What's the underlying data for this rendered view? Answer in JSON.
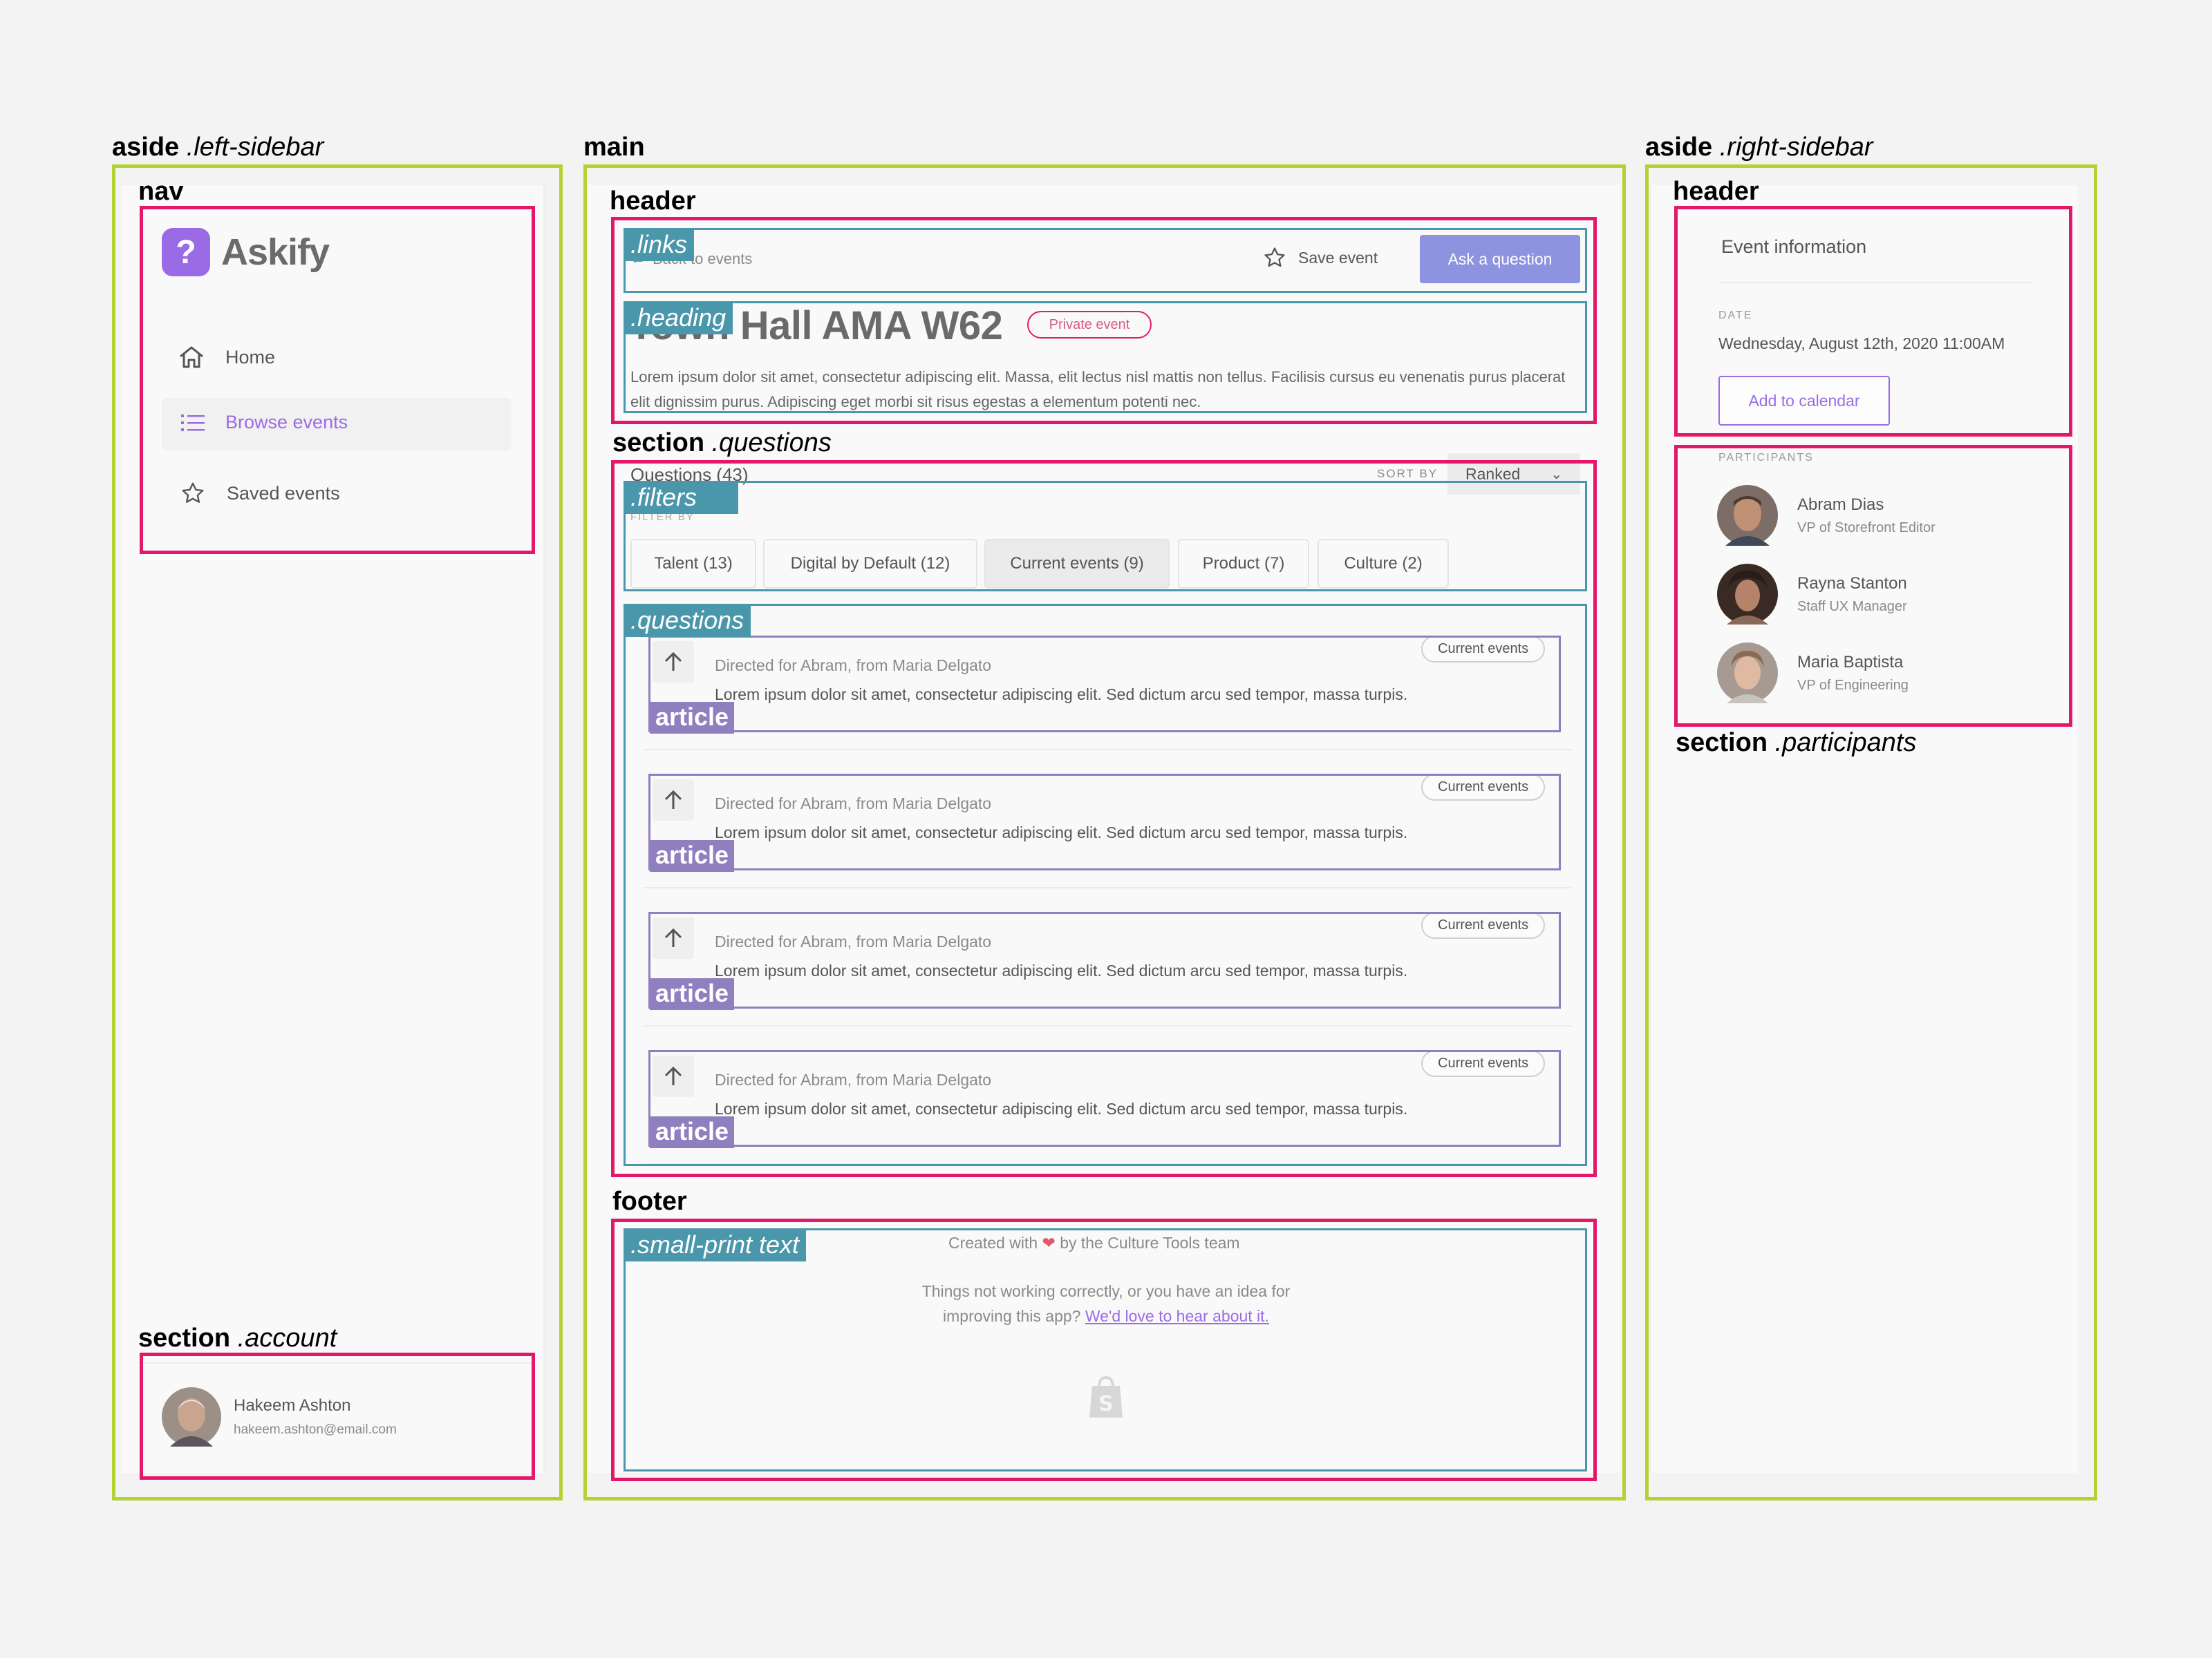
{
  "annotations": {
    "left_sidebar": {
      "tag": "aside",
      "cls": ".left-sidebar"
    },
    "main": "main",
    "right_sidebar": {
      "tag": "aside",
      "cls": ".right-sidebar"
    },
    "nav": "nav",
    "header": "header",
    "right_header": "header",
    "questions_section": {
      "tag": "section",
      "cls": ".questions"
    },
    "account_section": {
      "tag": "section",
      "cls": ".account"
    },
    "participants_section": {
      "tag": "section",
      "cls": ".participants"
    },
    "footer": "footer",
    "links": ".links",
    "heading": ".heading",
    "filters": ".filters",
    "questions": ".questions",
    "small_print": ".small-print text",
    "article": "article"
  },
  "app": {
    "name": "Askify",
    "logo_glyph": "?",
    "brand_color": "#9b6be6"
  },
  "nav": {
    "items": [
      {
        "label": "Home",
        "icon": "home-icon",
        "active": false
      },
      {
        "label": "Browse events",
        "icon": "list-icon",
        "active": true
      },
      {
        "label": "Saved events",
        "icon": "star-icon",
        "active": false
      }
    ]
  },
  "account": {
    "name": "Hakeem Ashton",
    "email": "hakeem.ashton@email.com"
  },
  "links": {
    "back": "Back to events",
    "save": "Save event",
    "ask": "Ask a question"
  },
  "event": {
    "title": "Town Hall AMA W62",
    "badge": "Private event",
    "description": "Lorem ipsum dolor sit amet, consectetur adipiscing elit. Massa, elit lectus nisl mattis non tellus. Facilisis cursus eu venenatis purus placerat elit dignissim purus. Adipiscing eget morbi sit risus egestas a elementum potenti nec."
  },
  "questions_header": {
    "title": "Questions (43)",
    "sort_label": "SORT BY",
    "sort_value": "Ranked"
  },
  "filters": {
    "label": "FILTER BY",
    "chips": [
      "Talent (13)",
      "Digital by Default (12)",
      "Current events (9)",
      "Product (7)",
      "Culture (2)"
    ]
  },
  "questions": [
    {
      "meta": "Directed for Abram, from Maria Delgato",
      "text": "Lorem ipsum dolor sit amet, consectetur adipiscing elit. Sed dictum arcu sed tempor, massa turpis.",
      "tag": "Current events"
    },
    {
      "meta": "Directed for Abram, from Maria Delgato",
      "text": "Lorem ipsum dolor sit amet, consectetur adipiscing elit. Sed dictum arcu sed tempor, massa turpis.",
      "tag": "Current events"
    },
    {
      "meta": "Directed for Abram, from Maria Delgato",
      "text": "Lorem ipsum dolor sit amet, consectetur adipiscing elit. Sed dictum arcu sed tempor, massa turpis.",
      "tag": "Current events"
    },
    {
      "meta": "Directed for Abram, from Maria Delgato",
      "text": "Lorem ipsum dolor sit amet, consectetur adipiscing elit. Sed dictum arcu sed tempor, massa turpis.",
      "tag": "Current events"
    }
  ],
  "footer": {
    "created_prefix": "Created with",
    "created_suffix": "by the Culture Tools team",
    "feedback_line1": "Things not working correctly, or you have an idea for",
    "feedback_line2": "improving this app?",
    "feedback_link": "We'd love to hear about it."
  },
  "event_info": {
    "title": "Event information",
    "date_label": "DATE",
    "date_value": "Wednesday, August 12th, 2020 11:00AM",
    "calendar_button": "Add to calendar"
  },
  "participants": {
    "label": "PARTICIPANTS",
    "people": [
      {
        "name": "Abram Dias",
        "title": "VP of Storefront Editor"
      },
      {
        "name": "Rayna Stanton",
        "title": "Staff UX Manager"
      },
      {
        "name": "Maria Baptista",
        "title": "VP of Engineering"
      }
    ]
  },
  "colors": {
    "accent": "#9b6be6",
    "heart": "#e05a6e",
    "badge": "#e3186a",
    "annotation_green": "#b3d234",
    "annotation_pink": "#e3186a",
    "annotation_teal": "#4a96aa",
    "annotation_purple": "#8f7fbf"
  }
}
